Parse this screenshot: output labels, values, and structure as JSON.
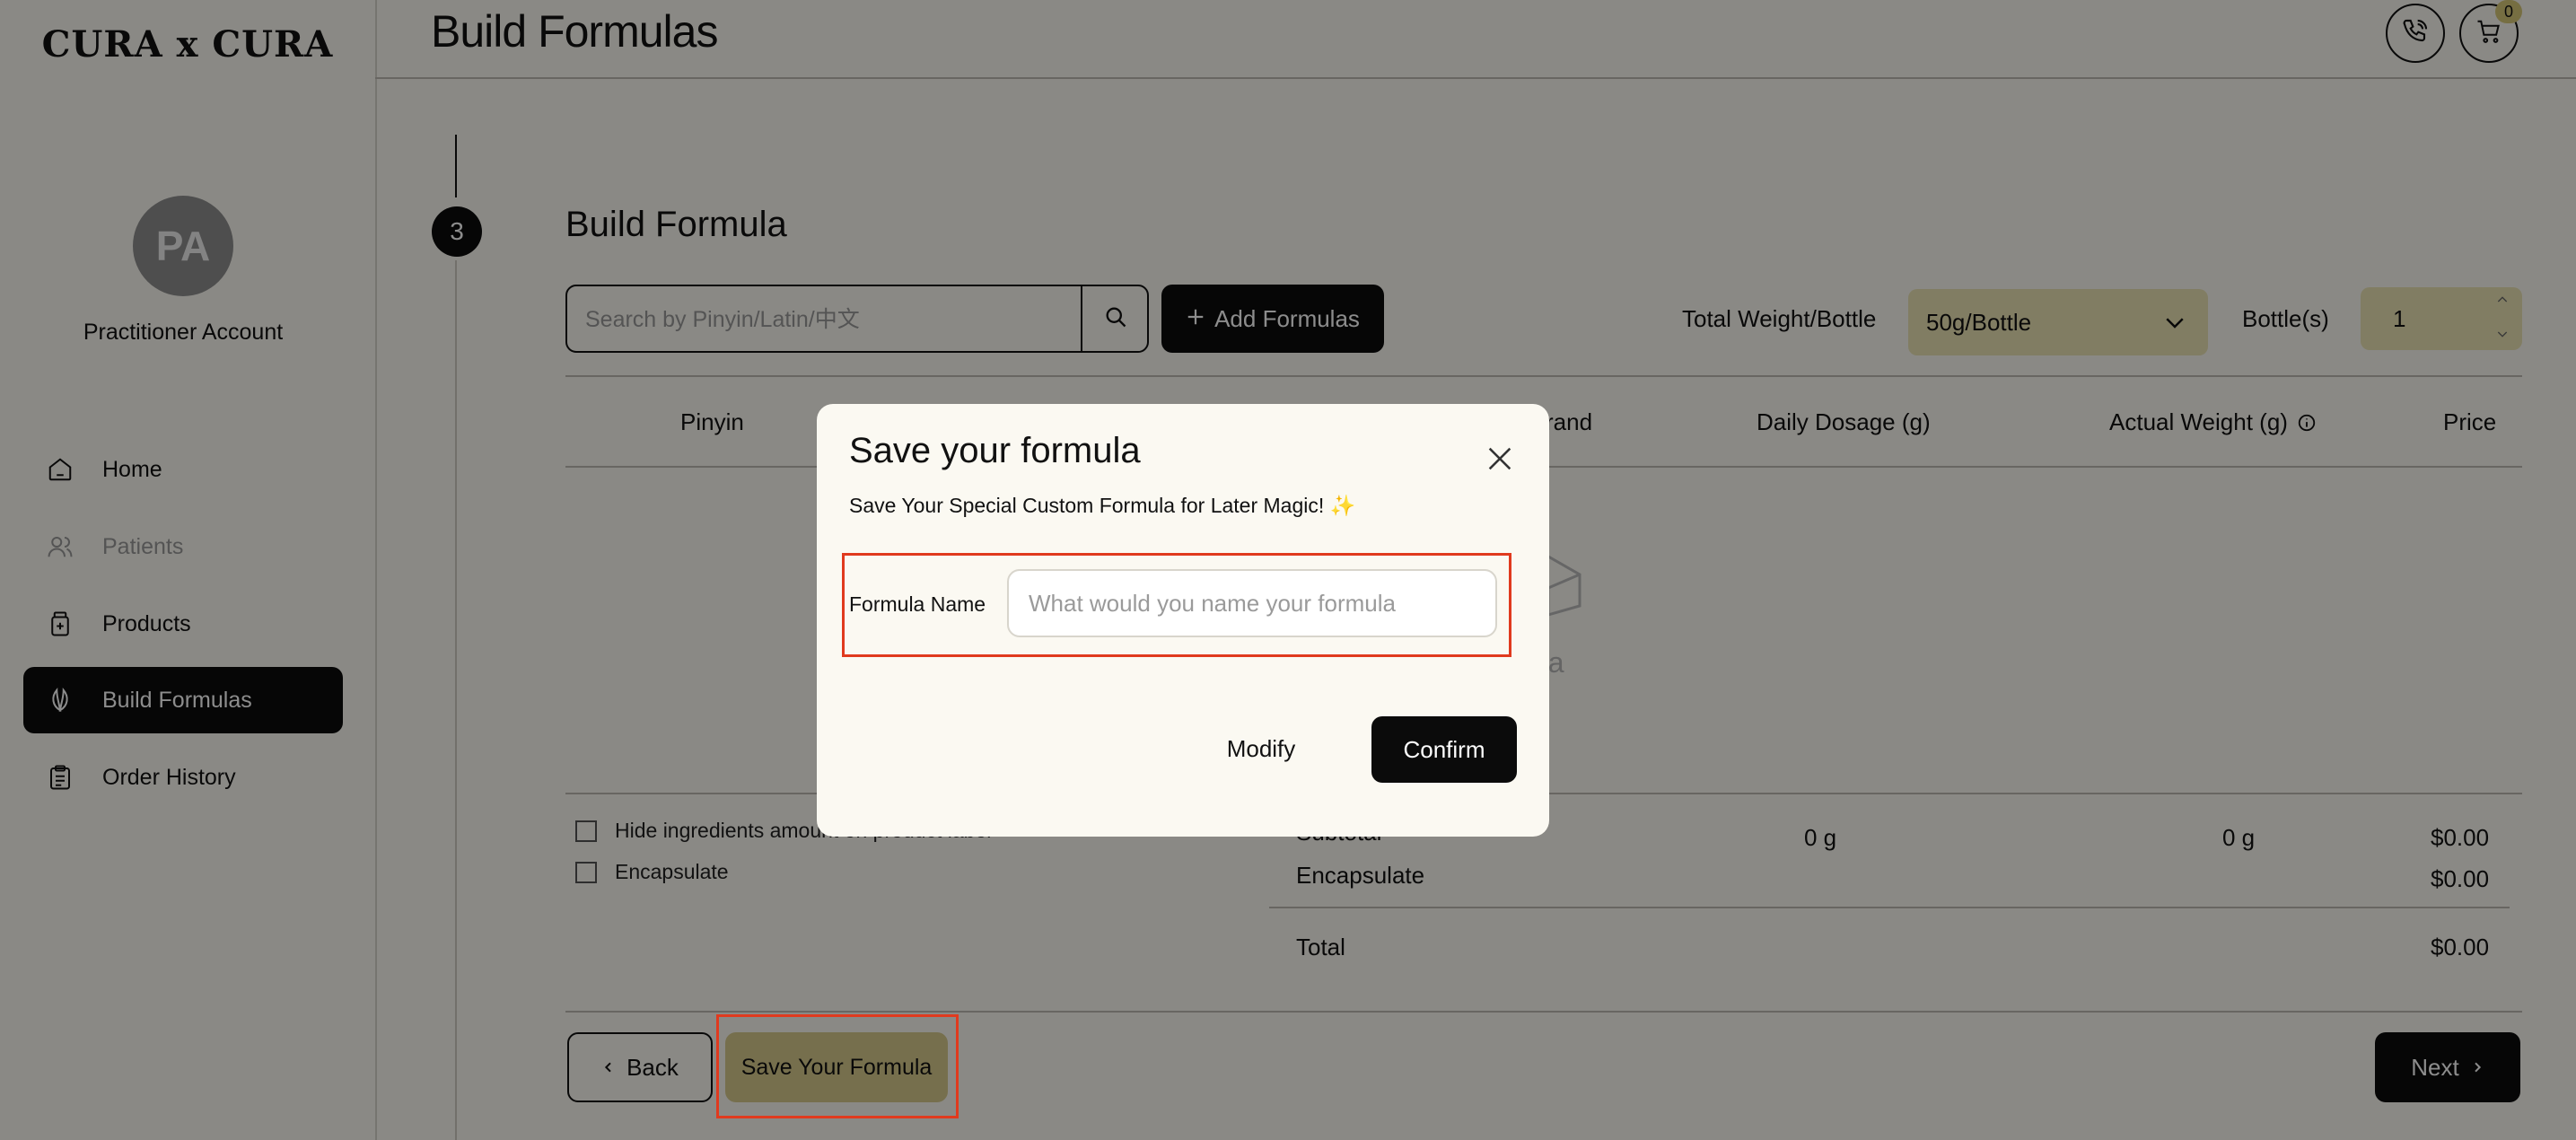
{
  "brand": {
    "logo": "CURA x CURA"
  },
  "account": {
    "initials": "PA",
    "name": "Practitioner Account"
  },
  "sidebar": {
    "items": [
      {
        "label": "Home",
        "icon": "home-icon"
      },
      {
        "label": "Patients",
        "icon": "users-icon",
        "disabled": true
      },
      {
        "label": "Products",
        "icon": "product-icon"
      },
      {
        "label": "Build Formulas",
        "icon": "leaf-icon",
        "active": true
      },
      {
        "label": "Order History",
        "icon": "clipboard-icon"
      }
    ]
  },
  "header": {
    "title": "Build Formulas",
    "cart_count": "0"
  },
  "step": {
    "number": "3",
    "title": "Build Formula"
  },
  "toolbar": {
    "search_placeholder": "Search by Pinyin/Latin/中文",
    "add_label": "Add Formulas",
    "total_weight_label": "Total Weight/Bottle",
    "weight_value": "50g/Bottle",
    "bottles_label": "Bottle(s)",
    "bottles_value": "1"
  },
  "table": {
    "headers": [
      "Pinyin",
      "rand",
      "Daily Dosage (g)",
      "Actual Weight (g)",
      "Price"
    ],
    "empty_text": "ata"
  },
  "options": {
    "hide_label": "Hide ingredients amount on product label",
    "encapsulate_label": "Encapsulate"
  },
  "summary": {
    "subtotal_label": "Subtotal",
    "daily_total": "0 g",
    "actual_total": "0 g",
    "subtotal_price": "$0.00",
    "encapsulate_label": "Encapsulate",
    "encapsulate_price": "$0.00",
    "total_label": "Total",
    "total_price": "$0.00"
  },
  "footer": {
    "back_label": "Back",
    "save_label": "Save Your Formula",
    "next_label": "Next"
  },
  "modal": {
    "title": "Save your formula",
    "subtitle": "Save Your Special Custom Formula for Later Magic! ✨",
    "field_label": "Formula Name",
    "field_placeholder": "What would you name your formula",
    "field_value": "",
    "modify_label": "Modify",
    "confirm_label": "Confirm"
  },
  "colors": {
    "accent": "#d8cb8c",
    "accent_light": "#ece4b4",
    "highlight": "#e03a1e",
    "dark": "#0b0b0b",
    "background": "#fbf9f2"
  }
}
